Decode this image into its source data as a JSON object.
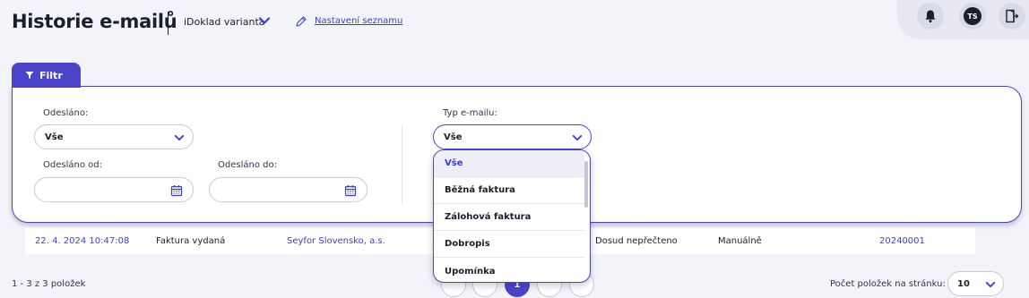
{
  "header": {
    "title": "Historie e-mailů",
    "variant": "iDoklad varianta",
    "settings_link": "Nastavení seznamu",
    "user_initials": "TS"
  },
  "filter": {
    "tab_label": "Filtr",
    "sent": {
      "label": "Odesláno:",
      "value": "Vše"
    },
    "sent_from": {
      "label": "Odesláno od:",
      "value": ""
    },
    "sent_to": {
      "label": "Odesláno do:",
      "value": ""
    },
    "email_type": {
      "label": "Typ e-mailu:",
      "value": "Vše",
      "options": [
        "Vše",
        "Běžná faktura",
        "Zálohová faktura",
        "Dobropis",
        "Upomínka"
      ],
      "selected_index": 0
    }
  },
  "table": {
    "rows": [
      {
        "date": "22. 4. 2024 10:47:08",
        "type": "Faktura vydaná",
        "partner": "Seyfor Slovensko, a.s.",
        "status": "Dosud nepřečteno",
        "mode": "Manuálně",
        "document": "20240001"
      }
    ]
  },
  "footer": {
    "count": "1 - 3 z 3 položek",
    "current_page": "1",
    "per_page_label": "Počet položek na stránku:",
    "per_page_value": "10"
  },
  "colors": {
    "accent": "#4b43c9",
    "link": "#3b3fcf",
    "background": "#f3f4fa",
    "text": "#1d1e2c"
  }
}
